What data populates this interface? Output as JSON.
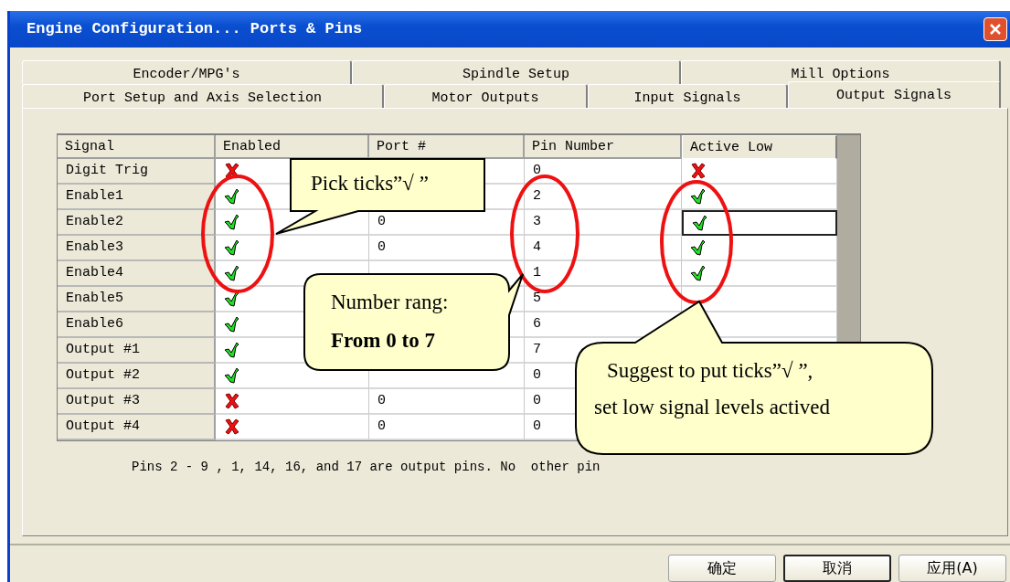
{
  "window": {
    "title": "Engine Configuration... Ports & Pins"
  },
  "tab_rows": [
    [
      {
        "label": "Encoder/MPG's",
        "selected": false
      },
      {
        "label": "Spindle Setup",
        "selected": false
      },
      {
        "label": "Mill Options",
        "selected": false
      }
    ],
    [
      {
        "label": "Port Setup and Axis Selection",
        "selected": false
      },
      {
        "label": "Motor Outputs",
        "selected": false
      },
      {
        "label": "Input Signals",
        "selected": false
      },
      {
        "label": "Output Signals",
        "selected": true
      }
    ]
  ],
  "table": {
    "columns": [
      "Signal",
      "Enabled",
      "Port #",
      "Pin Number",
      "Active Low"
    ],
    "rows": [
      {
        "signal": "Digit  Trig",
        "enabled": false,
        "pin": "0",
        "active_low": false,
        "focused": false
      },
      {
        "signal": "Enable1",
        "enabled": true,
        "pin": "2",
        "active_low": true,
        "focused": false
      },
      {
        "signal": "Enable2",
        "enabled": true,
        "port": "0",
        "pin": "3",
        "active_low": true,
        "focused": true
      },
      {
        "signal": "Enable3",
        "enabled": true,
        "port": "0",
        "pin": "4",
        "active_low": true,
        "focused": false
      },
      {
        "signal": "Enable4",
        "enabled": true,
        "pin": "1",
        "active_low": true,
        "focused": false
      },
      {
        "signal": "Enable5",
        "enabled": true,
        "pin": "5"
      },
      {
        "signal": "Enable6",
        "enabled": true,
        "pin": "6"
      },
      {
        "signal": "Output #1",
        "enabled": true,
        "pin": "7"
      },
      {
        "signal": "Output #2",
        "enabled": true,
        "pin": "0"
      },
      {
        "signal": "Output #3",
        "enabled": false,
        "port": "0",
        "pin": "0"
      },
      {
        "signal": "Output #4",
        "enabled": false,
        "port": "0",
        "pin": "0"
      }
    ]
  },
  "note": "Pins 2 - 9 , 1, 14, 16, and 17 are output pins. No  other pin",
  "buttons": [
    {
      "label": "确定",
      "default": false
    },
    {
      "label": "取消",
      "default": true
    },
    {
      "label": "应用(A)",
      "default": false
    }
  ],
  "annotations": [
    {
      "lines": [
        "Pick ticks”√ ”"
      ]
    },
    {
      "lines": [
        "Number rang:",
        "**From 0 to 7**"
      ]
    },
    {
      "lines": [
        "Suggest to put ticks”√ ”,",
        "set low signal levels actived"
      ]
    }
  ]
}
